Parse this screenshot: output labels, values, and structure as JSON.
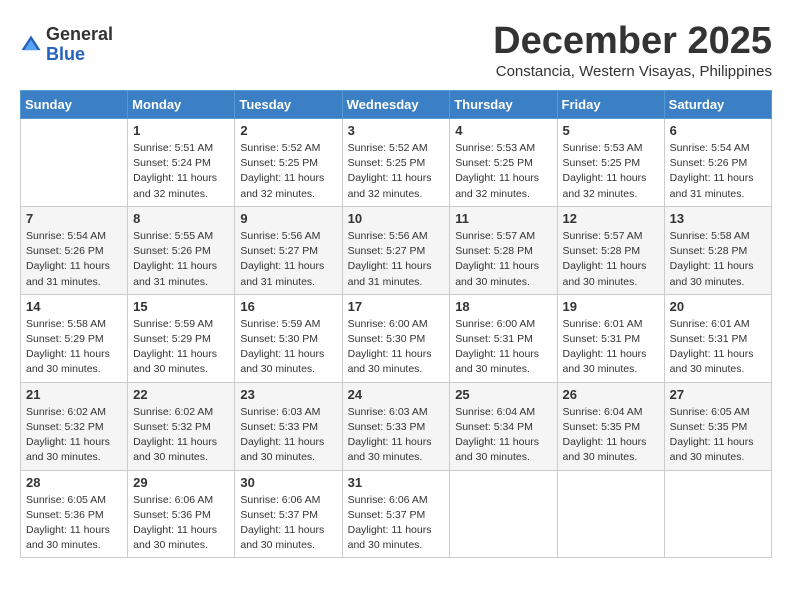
{
  "header": {
    "logo_general": "General",
    "logo_blue": "Blue",
    "month_title": "December 2025",
    "location": "Constancia, Western Visayas, Philippines"
  },
  "weekdays": [
    "Sunday",
    "Monday",
    "Tuesday",
    "Wednesday",
    "Thursday",
    "Friday",
    "Saturday"
  ],
  "weeks": [
    [
      {
        "day": "",
        "sunrise": "",
        "sunset": "",
        "daylight": ""
      },
      {
        "day": "1",
        "sunrise": "Sunrise: 5:51 AM",
        "sunset": "Sunset: 5:24 PM",
        "daylight": "Daylight: 11 hours and 32 minutes."
      },
      {
        "day": "2",
        "sunrise": "Sunrise: 5:52 AM",
        "sunset": "Sunset: 5:25 PM",
        "daylight": "Daylight: 11 hours and 32 minutes."
      },
      {
        "day": "3",
        "sunrise": "Sunrise: 5:52 AM",
        "sunset": "Sunset: 5:25 PM",
        "daylight": "Daylight: 11 hours and 32 minutes."
      },
      {
        "day": "4",
        "sunrise": "Sunrise: 5:53 AM",
        "sunset": "Sunset: 5:25 PM",
        "daylight": "Daylight: 11 hours and 32 minutes."
      },
      {
        "day": "5",
        "sunrise": "Sunrise: 5:53 AM",
        "sunset": "Sunset: 5:25 PM",
        "daylight": "Daylight: 11 hours and 32 minutes."
      },
      {
        "day": "6",
        "sunrise": "Sunrise: 5:54 AM",
        "sunset": "Sunset: 5:26 PM",
        "daylight": "Daylight: 11 hours and 31 minutes."
      }
    ],
    [
      {
        "day": "7",
        "sunrise": "Sunrise: 5:54 AM",
        "sunset": "Sunset: 5:26 PM",
        "daylight": "Daylight: 11 hours and 31 minutes."
      },
      {
        "day": "8",
        "sunrise": "Sunrise: 5:55 AM",
        "sunset": "Sunset: 5:26 PM",
        "daylight": "Daylight: 11 hours and 31 minutes."
      },
      {
        "day": "9",
        "sunrise": "Sunrise: 5:56 AM",
        "sunset": "Sunset: 5:27 PM",
        "daylight": "Daylight: 11 hours and 31 minutes."
      },
      {
        "day": "10",
        "sunrise": "Sunrise: 5:56 AM",
        "sunset": "Sunset: 5:27 PM",
        "daylight": "Daylight: 11 hours and 31 minutes."
      },
      {
        "day": "11",
        "sunrise": "Sunrise: 5:57 AM",
        "sunset": "Sunset: 5:28 PM",
        "daylight": "Daylight: 11 hours and 30 minutes."
      },
      {
        "day": "12",
        "sunrise": "Sunrise: 5:57 AM",
        "sunset": "Sunset: 5:28 PM",
        "daylight": "Daylight: 11 hours and 30 minutes."
      },
      {
        "day": "13",
        "sunrise": "Sunrise: 5:58 AM",
        "sunset": "Sunset: 5:28 PM",
        "daylight": "Daylight: 11 hours and 30 minutes."
      }
    ],
    [
      {
        "day": "14",
        "sunrise": "Sunrise: 5:58 AM",
        "sunset": "Sunset: 5:29 PM",
        "daylight": "Daylight: 11 hours and 30 minutes."
      },
      {
        "day": "15",
        "sunrise": "Sunrise: 5:59 AM",
        "sunset": "Sunset: 5:29 PM",
        "daylight": "Daylight: 11 hours and 30 minutes."
      },
      {
        "day": "16",
        "sunrise": "Sunrise: 5:59 AM",
        "sunset": "Sunset: 5:30 PM",
        "daylight": "Daylight: 11 hours and 30 minutes."
      },
      {
        "day": "17",
        "sunrise": "Sunrise: 6:00 AM",
        "sunset": "Sunset: 5:30 PM",
        "daylight": "Daylight: 11 hours and 30 minutes."
      },
      {
        "day": "18",
        "sunrise": "Sunrise: 6:00 AM",
        "sunset": "Sunset: 5:31 PM",
        "daylight": "Daylight: 11 hours and 30 minutes."
      },
      {
        "day": "19",
        "sunrise": "Sunrise: 6:01 AM",
        "sunset": "Sunset: 5:31 PM",
        "daylight": "Daylight: 11 hours and 30 minutes."
      },
      {
        "day": "20",
        "sunrise": "Sunrise: 6:01 AM",
        "sunset": "Sunset: 5:31 PM",
        "daylight": "Daylight: 11 hours and 30 minutes."
      }
    ],
    [
      {
        "day": "21",
        "sunrise": "Sunrise: 6:02 AM",
        "sunset": "Sunset: 5:32 PM",
        "daylight": "Daylight: 11 hours and 30 minutes."
      },
      {
        "day": "22",
        "sunrise": "Sunrise: 6:02 AM",
        "sunset": "Sunset: 5:32 PM",
        "daylight": "Daylight: 11 hours and 30 minutes."
      },
      {
        "day": "23",
        "sunrise": "Sunrise: 6:03 AM",
        "sunset": "Sunset: 5:33 PM",
        "daylight": "Daylight: 11 hours and 30 minutes."
      },
      {
        "day": "24",
        "sunrise": "Sunrise: 6:03 AM",
        "sunset": "Sunset: 5:33 PM",
        "daylight": "Daylight: 11 hours and 30 minutes."
      },
      {
        "day": "25",
        "sunrise": "Sunrise: 6:04 AM",
        "sunset": "Sunset: 5:34 PM",
        "daylight": "Daylight: 11 hours and 30 minutes."
      },
      {
        "day": "26",
        "sunrise": "Sunrise: 6:04 AM",
        "sunset": "Sunset: 5:35 PM",
        "daylight": "Daylight: 11 hours and 30 minutes."
      },
      {
        "day": "27",
        "sunrise": "Sunrise: 6:05 AM",
        "sunset": "Sunset: 5:35 PM",
        "daylight": "Daylight: 11 hours and 30 minutes."
      }
    ],
    [
      {
        "day": "28",
        "sunrise": "Sunrise: 6:05 AM",
        "sunset": "Sunset: 5:36 PM",
        "daylight": "Daylight: 11 hours and 30 minutes."
      },
      {
        "day": "29",
        "sunrise": "Sunrise: 6:06 AM",
        "sunset": "Sunset: 5:36 PM",
        "daylight": "Daylight: 11 hours and 30 minutes."
      },
      {
        "day": "30",
        "sunrise": "Sunrise: 6:06 AM",
        "sunset": "Sunset: 5:37 PM",
        "daylight": "Daylight: 11 hours and 30 minutes."
      },
      {
        "day": "31",
        "sunrise": "Sunrise: 6:06 AM",
        "sunset": "Sunset: 5:37 PM",
        "daylight": "Daylight: 11 hours and 30 minutes."
      },
      {
        "day": "",
        "sunrise": "",
        "sunset": "",
        "daylight": ""
      },
      {
        "day": "",
        "sunrise": "",
        "sunset": "",
        "daylight": ""
      },
      {
        "day": "",
        "sunrise": "",
        "sunset": "",
        "daylight": ""
      }
    ]
  ]
}
